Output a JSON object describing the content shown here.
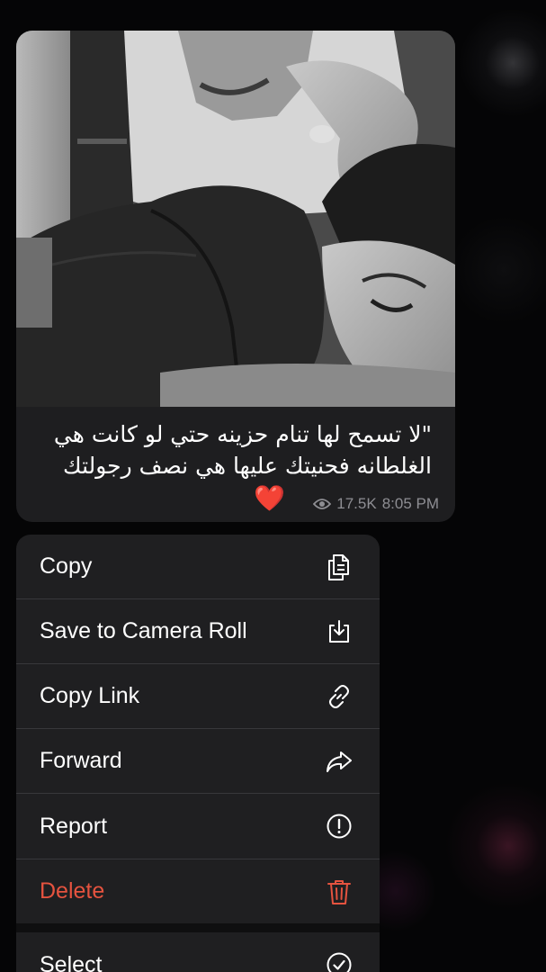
{
  "message": {
    "caption_line1": "\"لا تسمح لها تنام حزينه حتي لو كانت هي",
    "caption_line2": "الغلطانه فحنيتك عليها هي نصف رجولتك",
    "heart": "❤️",
    "views": "17.5K",
    "time": "8:05 PM",
    "view_icon": "eye-icon"
  },
  "menu": {
    "items": [
      {
        "label": "Copy",
        "icon": "copy-icon"
      },
      {
        "label": "Save to Camera Roll",
        "icon": "download-icon"
      },
      {
        "label": "Copy Link",
        "icon": "link-icon"
      },
      {
        "label": "Forward",
        "icon": "forward-icon"
      },
      {
        "label": "Report",
        "icon": "report-icon"
      },
      {
        "label": "Delete",
        "icon": "trash-icon",
        "destructive": true
      },
      {
        "label": "Select",
        "icon": "checkmark-circle-icon"
      }
    ]
  },
  "colors": {
    "destructive": "#e5533f",
    "bubble": "#1e1e20",
    "menu_bg": "#1f1f21",
    "meta_text": "#8e8e93"
  }
}
